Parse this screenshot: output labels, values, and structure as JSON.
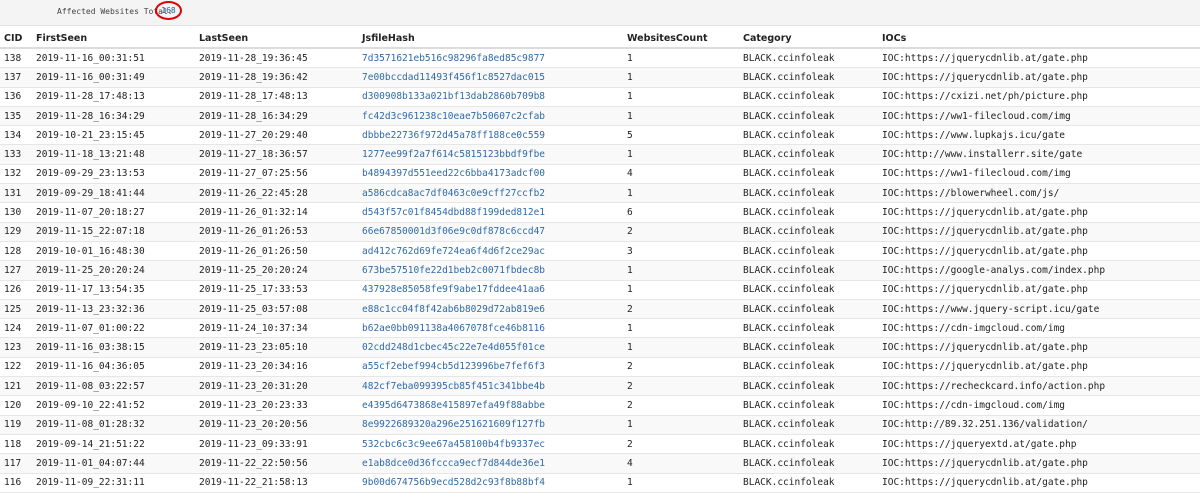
{
  "summary": {
    "label": "Affected Websites Total:",
    "count": "168"
  },
  "table": {
    "headers": [
      "CID",
      "FirstSeen",
      "LastSeen",
      "JsfileHash",
      "WebsitesCount",
      "Category",
      "IOCs"
    ],
    "rows": [
      [
        "138",
        "2019-11-16_00:31:51",
        "2019-11-28_19:36:45",
        "7d3571621eb516c98296fa8ed85c9877",
        "1",
        "BLACK.ccinfoleak",
        "IOC:https://jquerycdnlib.at/gate.php"
      ],
      [
        "137",
        "2019-11-16_00:31:49",
        "2019-11-28_19:36:42",
        "7e00bccdad11493f456f1c8527dac015",
        "1",
        "BLACK.ccinfoleak",
        "IOC:https://jquerycdnlib.at/gate.php"
      ],
      [
        "136",
        "2019-11-28_17:48:13",
        "2019-11-28_17:48:13",
        "d300908b133a021bf13dab2860b709b8",
        "1",
        "BLACK.ccinfoleak",
        "IOC:https://cxizi.net/ph/picture.php"
      ],
      [
        "135",
        "2019-11-28_16:34:29",
        "2019-11-28_16:34:29",
        "fc42d3c961238c10eae7b50607c2cfab",
        "1",
        "BLACK.ccinfoleak",
        "IOC:https://ww1-filecloud.com/img"
      ],
      [
        "134",
        "2019-10-21_23:15:45",
        "2019-11-27_20:29:40",
        "dbbbe22736f972d45a78ff188ce0c559",
        "5",
        "BLACK.ccinfoleak",
        "IOC:https://www.lupkajs.icu/gate"
      ],
      [
        "133",
        "2019-11-18_13:21:48",
        "2019-11-27_18:36:57",
        "1277ee99f2a7f614c5815123bbdf9fbe",
        "1",
        "BLACK.ccinfoleak",
        "IOC:http://www.installerr.site/gate"
      ],
      [
        "132",
        "2019-09-29_23:13:53",
        "2019-11-27_07:25:56",
        "b4894397d551eed22c6bba4173adcf00",
        "4",
        "BLACK.ccinfoleak",
        "IOC:https://ww1-filecloud.com/img"
      ],
      [
        "131",
        "2019-09-29_18:41:44",
        "2019-11-26_22:45:28",
        "a586cdca8ac7df0463c0e9cff27ccfb2",
        "1",
        "BLACK.ccinfoleak",
        "IOC:https://blowerwheel.com/js/"
      ],
      [
        "130",
        "2019-11-07_20:18:27",
        "2019-11-26_01:32:14",
        "d543f57c01f8454dbd88f199ded812e1",
        "6",
        "BLACK.ccinfoleak",
        "IOC:https://jquerycdnlib.at/gate.php"
      ],
      [
        "129",
        "2019-11-15_22:07:18",
        "2019-11-26_01:26:53",
        "66e67850001d3f06e9c0df878c6ccd47",
        "2",
        "BLACK.ccinfoleak",
        "IOC:https://jquerycdnlib.at/gate.php"
      ],
      [
        "128",
        "2019-10-01_16:48:30",
        "2019-11-26_01:26:50",
        "ad412c762d69fe724ea6f4d6f2ce29ac",
        "3",
        "BLACK.ccinfoleak",
        "IOC:https://jquerycdnlib.at/gate.php"
      ],
      [
        "127",
        "2019-11-25_20:20:24",
        "2019-11-25_20:20:24",
        "673be57510fe22d1beb2c0071fbdec8b",
        "1",
        "BLACK.ccinfoleak",
        "IOC:https://google-analys.com/index.php"
      ],
      [
        "126",
        "2019-11-17_13:54:35",
        "2019-11-25_17:33:53",
        "437928e85058fe9f9abe17fddee41aa6",
        "1",
        "BLACK.ccinfoleak",
        "IOC:https://jquerycdnlib.at/gate.php"
      ],
      [
        "125",
        "2019-11-13_23:32:36",
        "2019-11-25_03:57:08",
        "e88c1cc04f8f42ab6b8029d72ab819e6",
        "2",
        "BLACK.ccinfoleak",
        "IOC:https://www.jquery-script.icu/gate"
      ],
      [
        "124",
        "2019-11-07_01:00:22",
        "2019-11-24_10:37:34",
        "b62ae0bb091138a4067078fce46b8116",
        "1",
        "BLACK.ccinfoleak",
        "IOC:https://cdn-imgcloud.com/img"
      ],
      [
        "123",
        "2019-11-16_03:38:15",
        "2019-11-23_23:05:10",
        "02cdd248d1cbec45c22e7e4d055f01ce",
        "1",
        "BLACK.ccinfoleak",
        "IOC:https://jquerycdnlib.at/gate.php"
      ],
      [
        "122",
        "2019-11-16_04:36:05",
        "2019-11-23_20:34:16",
        "a55cf2ebef994cb5d123996be7fef6f3",
        "2",
        "BLACK.ccinfoleak",
        "IOC:https://jquerycdnlib.at/gate.php"
      ],
      [
        "121",
        "2019-11-08_03:22:57",
        "2019-11-23_20:31:20",
        "482cf7eba099395cb85f451c341bbe4b",
        "2",
        "BLACK.ccinfoleak",
        "IOC:https://recheckcard.info/action.php"
      ],
      [
        "120",
        "2019-09-10_22:41:52",
        "2019-11-23_20:23:33",
        "e4395d6473868e415897efa49f88abbe",
        "2",
        "BLACK.ccinfoleak",
        "IOC:https://cdn-imgcloud.com/img"
      ],
      [
        "119",
        "2019-11-08_01:28:32",
        "2019-11-23_20:20:56",
        "8e9922689320a296e251621609f127fb",
        "1",
        "BLACK.ccinfoleak",
        "IOC:http://89.32.251.136/validation/"
      ],
      [
        "118",
        "2019-09-14_21:51:22",
        "2019-11-23_09:33:91",
        "532cbc6c3c9ee67a458100b4fb9337ec",
        "2",
        "BLACK.ccinfoleak",
        "IOC:https://jqueryextd.at/gate.php"
      ],
      [
        "117",
        "2019-11-01_04:07:44",
        "2019-11-22_22:50:56",
        "e1ab8dce0d36fccca9ecf7d844de36e1",
        "4",
        "BLACK.ccinfoleak",
        "IOC:https://jquerycdnlib.at/gate.php"
      ],
      [
        "116",
        "2019-11-09_22:31:11",
        "2019-11-22_21:58:13",
        "9b00d674756b9ecd528d2c93f8b88bf4",
        "1",
        "BLACK.ccinfoleak",
        "IOC:https://jquerycdnlib.at/gate.php"
      ]
    ]
  }
}
